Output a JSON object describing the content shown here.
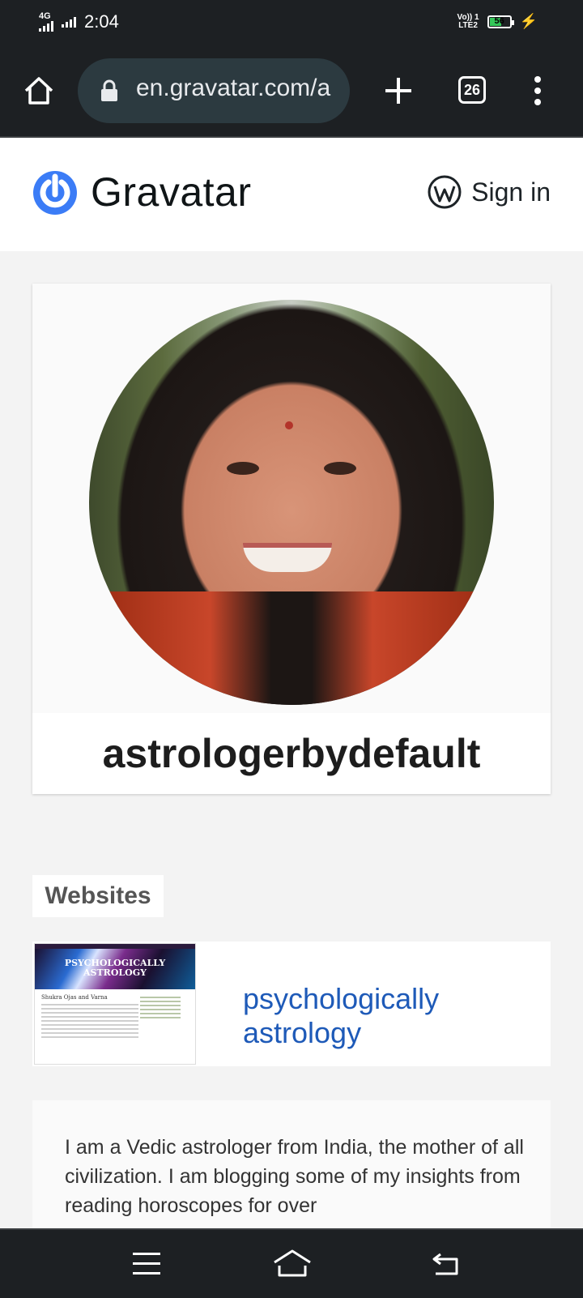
{
  "status_bar": {
    "network": "4G",
    "time": "2:04",
    "volte": "Vo)) 1\nLTE2",
    "battery": "56"
  },
  "browser": {
    "url": "en.gravatar.com/a",
    "tab_count": "26"
  },
  "header": {
    "brand": "Gravatar",
    "sign_in": "Sign in"
  },
  "profile": {
    "username": "astrologerbydefault"
  },
  "websites": {
    "heading": "Websites",
    "items": [
      {
        "thumb_title": "PSYCHOLOGICALLY ASTROLOGY",
        "thumb_post_title": "Shukra Ojas and Varna",
        "link_line1": "psychologically",
        "link_line2": "astrology"
      }
    ]
  },
  "about": {
    "text": "I am a Vedic astrologer from India, the mother of all civilization. I am blogging some of my insights from reading horoscopes for over"
  },
  "colors": {
    "brand_blue": "#3b7cf6",
    "link_blue": "#1e5ab8",
    "chrome_dark": "#1d2023"
  }
}
